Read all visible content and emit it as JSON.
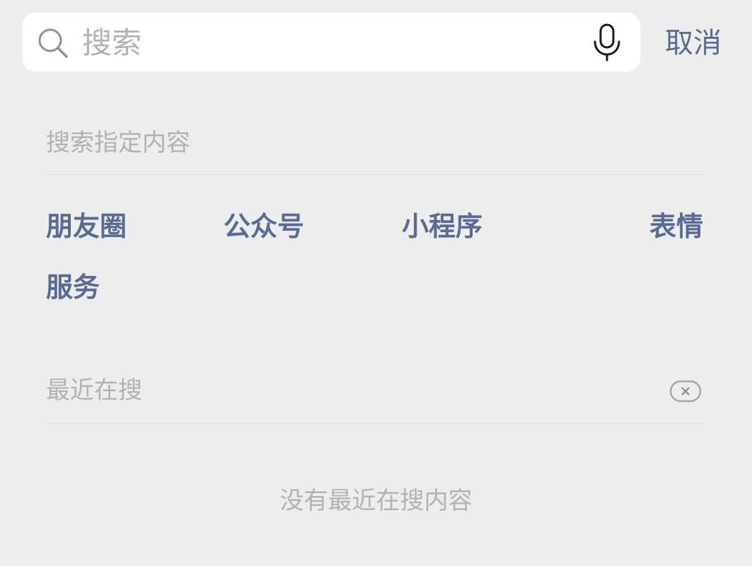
{
  "search": {
    "placeholder": "搜索",
    "value": ""
  },
  "cancel_label": "取消",
  "specified_section": {
    "title": "搜索指定内容",
    "categories": [
      "朋友圈",
      "公众号",
      "小程序",
      "表情",
      "服务"
    ]
  },
  "recent_section": {
    "title": "最近在搜",
    "empty_text": "没有最近在搜内容"
  },
  "icons": {
    "search": "search-icon",
    "microphone": "microphone-icon",
    "clear": "clear-history-icon"
  },
  "colors": {
    "background": "#ededed",
    "link": "#576b95",
    "muted_text": "#b2b2b2",
    "search_bar": "#ffffff"
  }
}
